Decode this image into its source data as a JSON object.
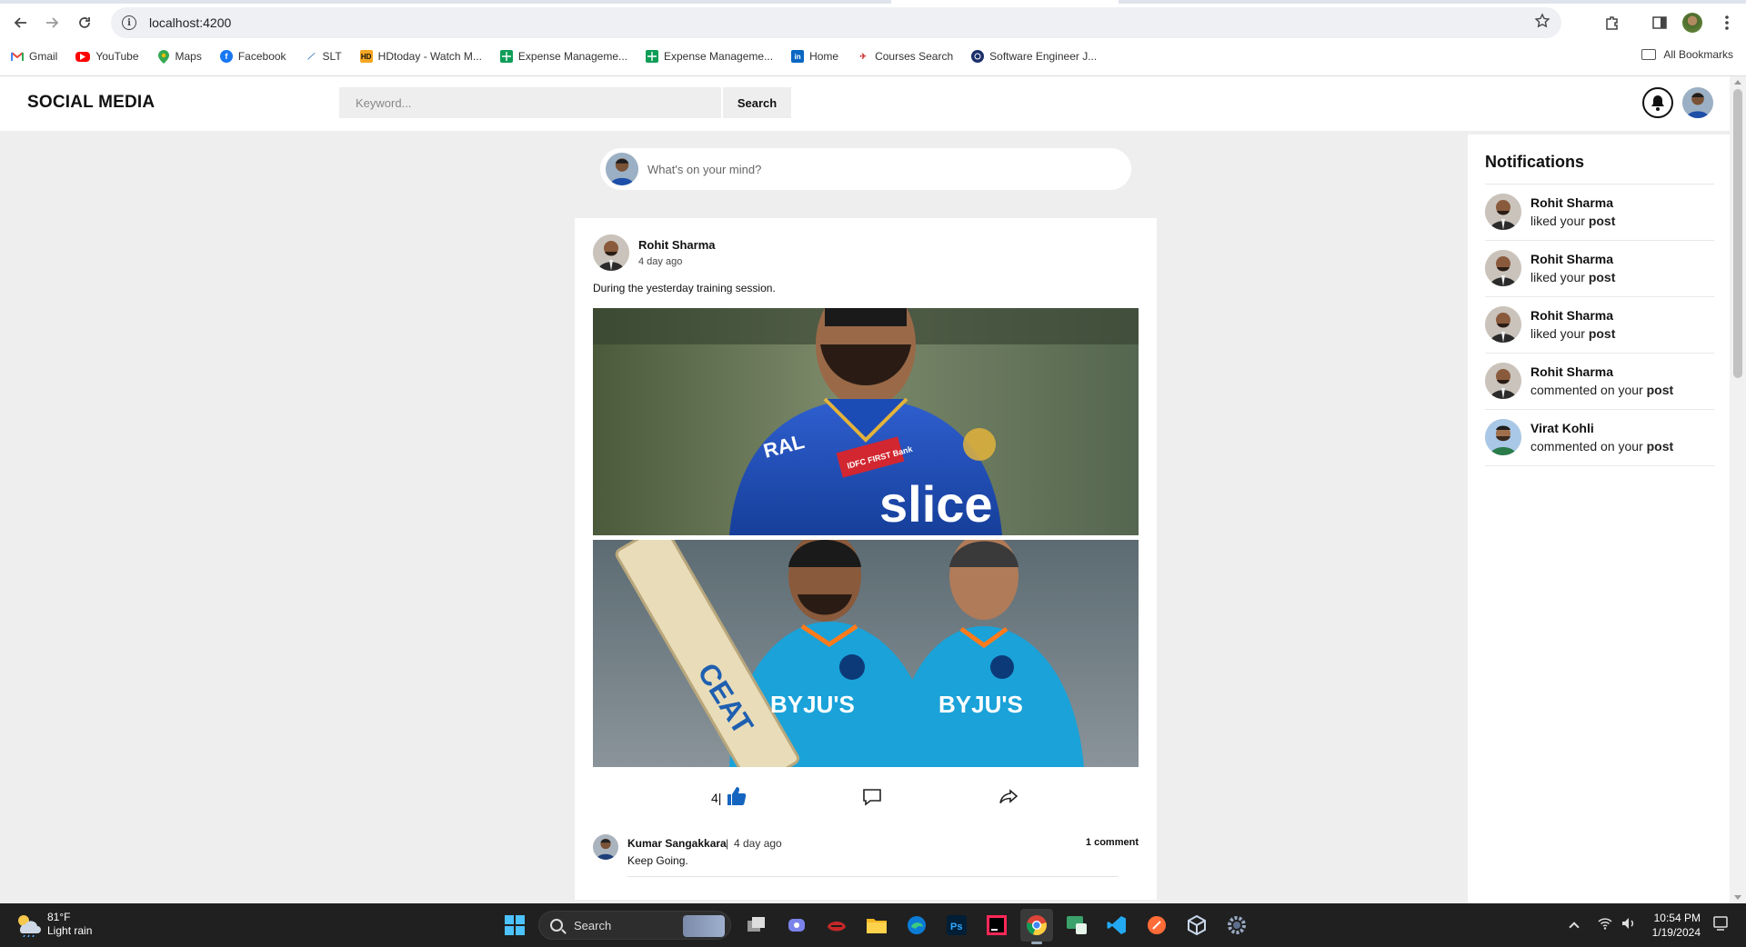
{
  "browser": {
    "url": "localhost:4200",
    "bookmarks": [
      "Gmail",
      "YouTube",
      "Maps",
      "Facebook",
      "SLT",
      "HDtoday - Watch M...",
      "Expense Manageme...",
      "Expense Manageme...",
      "Home",
      "Courses Search",
      "Software Engineer J..."
    ],
    "all_bookmarks": "All Bookmarks"
  },
  "app": {
    "title": "SOCIAL MEDIA",
    "search_placeholder": "Keyword...",
    "search_button": "Search"
  },
  "composer": {
    "placeholder": "What's on your mind?"
  },
  "post": {
    "author": "Rohit Sharma",
    "time": "4 day ago",
    "caption": "During the yesterday training session.",
    "likes": "4",
    "like_separator": "|",
    "photo_texts": [
      "RAL",
      "IDFC FIRST Bank",
      "slice",
      "CEAT",
      "BYJU'S",
      "BYJU'S"
    ],
    "comment": {
      "author": "Kumar Sangakkara",
      "separator": "|",
      "time": "4 day ago",
      "text": "Keep Going.",
      "count_label": "1 comment"
    }
  },
  "notifications": {
    "title": "Notifications",
    "items": [
      {
        "name": "Rohit Sharma",
        "action": "liked your",
        "target": "post"
      },
      {
        "name": "Rohit Sharma",
        "action": "liked your",
        "target": "post"
      },
      {
        "name": "Rohit Sharma",
        "action": "liked your",
        "target": "post"
      },
      {
        "name": "Rohit Sharma",
        "action": "commented on your",
        "target": "post"
      },
      {
        "name": "Virat Kohli",
        "action": "commented on your",
        "target": "post"
      }
    ]
  },
  "taskbar": {
    "temperature": "81°F",
    "weather": "Light rain",
    "search_label": "Search",
    "time": "10:54 PM",
    "date": "1/19/2024"
  },
  "colors": {
    "page_bg": "#eeeeee",
    "card_bg": "#ffffff",
    "like_blue": "#1565c0",
    "taskbar_bg": "#202020"
  }
}
